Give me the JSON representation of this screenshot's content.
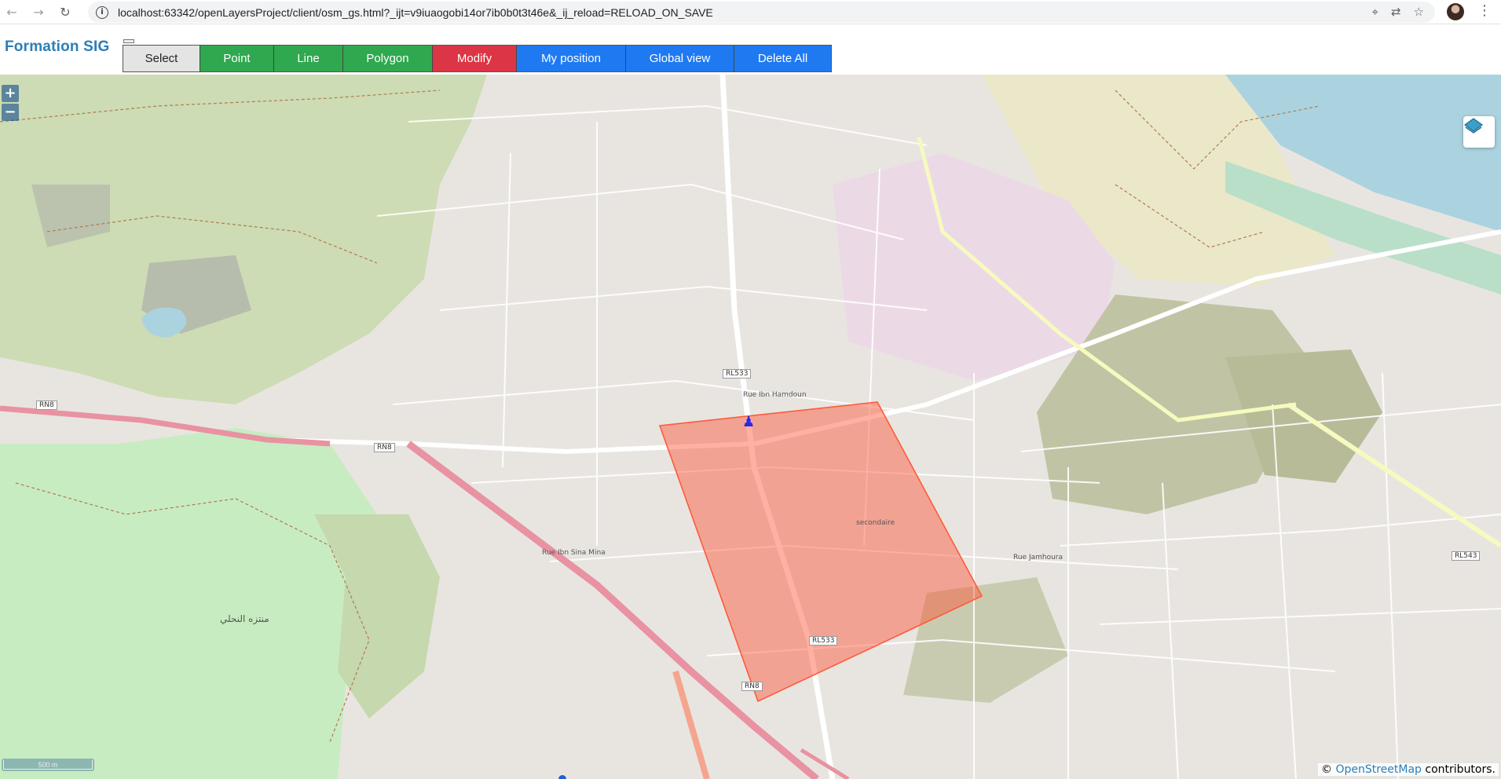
{
  "browser": {
    "url": "localhost:63342/openLayersProject/client/osm_gs.html?_ijt=v9iuaogobi14or7ib0b0t3t46e&_ij_reload=RELOAD_ON_SAVE",
    "back_glyph": "←",
    "forward_glyph": "→",
    "reload_glyph": "↻",
    "site_info_glyph": "i",
    "icons": [
      "location-icon",
      "translate-icon",
      "star-icon"
    ],
    "location_glyph": "⌖",
    "translate_glyph": "⇄",
    "star_glyph": "☆",
    "menu_glyph": "⋮"
  },
  "app": {
    "title": "Formation SIG",
    "toolbar": {
      "select": "Select",
      "point": "Point",
      "line": "Line",
      "polygon": "Polygon",
      "modify": "Modify",
      "my_position": "My position",
      "global_view": "Global view",
      "delete_all": "Delete All"
    },
    "colors": {
      "select": "#e4e4e4",
      "draw_buttons": "#2fa84f",
      "modify": "#dc3545",
      "view_buttons": "#1f7af2",
      "title": "#2b7fb7",
      "polygon_fill": "rgba(255,80,50,0.45)",
      "polygon_stroke": "#ff5a3a",
      "position_marker": "#2d29e0"
    }
  },
  "map": {
    "zoom_in": "+",
    "zoom_out": "−",
    "scale": "500 m",
    "attribution_prefix": "©",
    "attribution_link": "OpenStreetMap",
    "attribution_suffix": "contributors.",
    "marker_glyph": "♟",
    "road_labels": {
      "rl533_a": "RL533",
      "rl533_b": "RL533",
      "rn8_a": "RN8",
      "rn8_b": "RN8",
      "rn8_c": "RN8",
      "rl543": "RL543"
    },
    "place_labels": {
      "rue_ibn_hamdoun": "Rue Ibn Hamdoun",
      "secondaire": "secondaire",
      "rue_jamhour": "Rue Jamhoura",
      "park_name": "منتزه النحلي",
      "rue_ibn_sina": "Rue Ibn Sina Mina"
    }
  }
}
